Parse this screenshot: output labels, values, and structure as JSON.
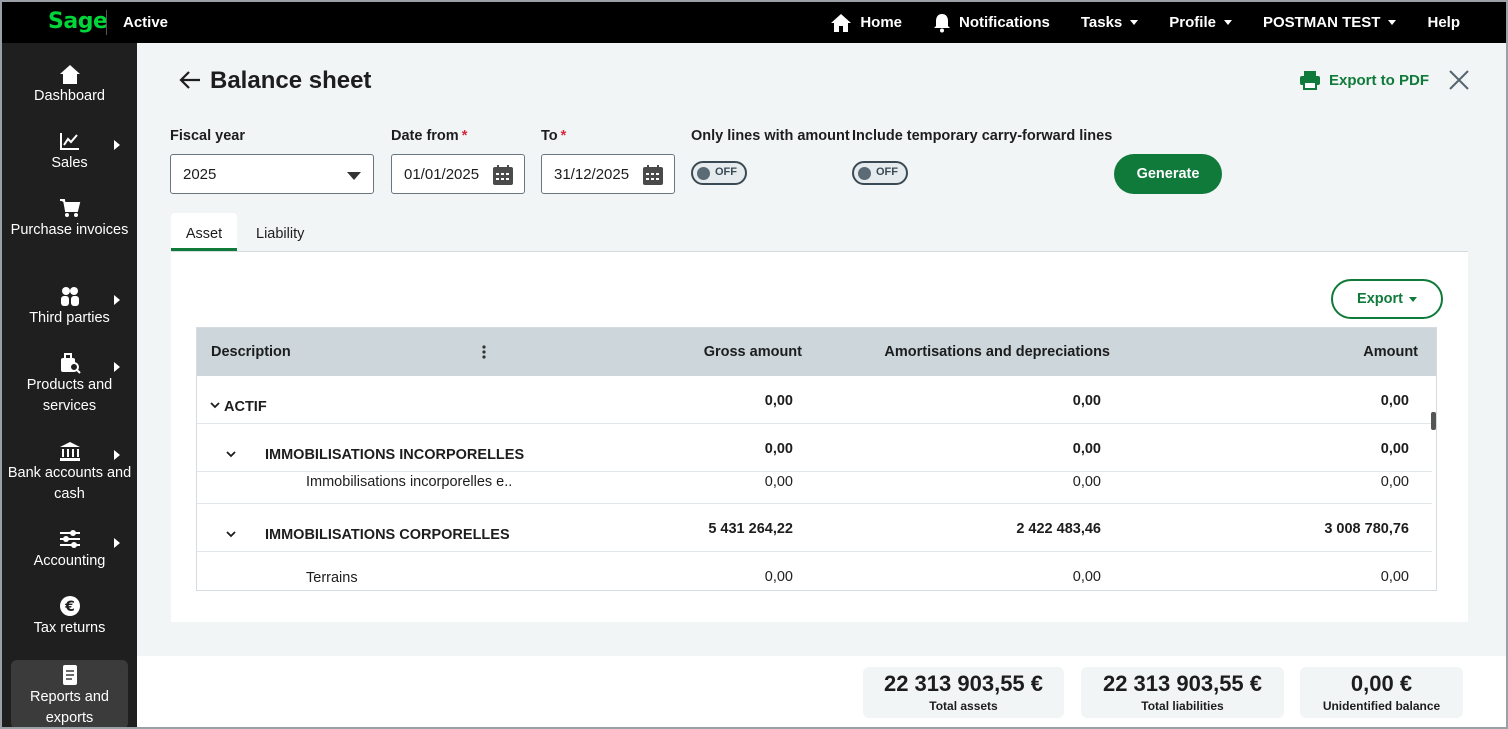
{
  "topbar": {
    "logo": "Sage",
    "company_status": "Active",
    "nav": {
      "home": "Home",
      "notifications": "Notifications",
      "tasks": "Tasks",
      "profile": "Profile",
      "user": "POSTMAN TEST",
      "help": "Help"
    }
  },
  "sidebar": {
    "items": [
      {
        "label": "Dashboard",
        "icon": "home-icon"
      },
      {
        "label": "Sales",
        "icon": "chart-icon"
      },
      {
        "label": "Purchase invoices",
        "icon": "cart-icon"
      },
      {
        "label": "Third parties",
        "icon": "people-icon"
      },
      {
        "label": "Products and services",
        "icon": "box-search-icon"
      },
      {
        "label": "Bank accounts and cash",
        "icon": "bank-icon"
      },
      {
        "label": "Accounting",
        "icon": "sliders-icon"
      },
      {
        "label": "Tax returns",
        "icon": "euro-icon"
      },
      {
        "label": "Reports and exports",
        "icon": "report-icon"
      }
    ]
  },
  "page": {
    "title": "Balance sheet",
    "export_pdf": "Export to PDF"
  },
  "filters": {
    "fiscal_year_label": "Fiscal year",
    "fiscal_year_value": "2025",
    "date_from_label": "Date from",
    "date_from_value": "01/01/2025",
    "to_label": "To",
    "to_value": "31/12/2025",
    "required_mark": "*",
    "only_lines_label": "Only lines with amount",
    "only_lines_state": "OFF",
    "carry_forward_label": "Include temporary carry-forward lines",
    "carry_forward_state": "OFF",
    "generate": "Generate"
  },
  "tabs": {
    "asset": "Asset",
    "liability": "Liability"
  },
  "table": {
    "export": "Export",
    "columns": {
      "description": "Description",
      "gross": "Gross amount",
      "amort": "Amortisations and depreciations",
      "amount": "Amount"
    },
    "rows": [
      {
        "label": "ACTIF",
        "gross": "0,00",
        "amort": "0,00",
        "amount": "0,00"
      },
      {
        "label": "IMMOBILISATIONS INCORPORELLES",
        "gross": "0,00",
        "amort": "0,00",
        "amount": "0,00"
      },
      {
        "label": "Immobilisations incorporelles e..",
        "gross": "0,00",
        "amort": "0,00",
        "amount": "0,00"
      },
      {
        "label": "IMMOBILISATIONS CORPORELLES",
        "gross": "5 431 264,22",
        "amort": "2 422 483,46",
        "amount": "3 008 780,76"
      },
      {
        "label": "Terrains",
        "gross": "0,00",
        "amort": "0,00",
        "amount": "0,00"
      }
    ]
  },
  "totals": {
    "assets_value": "22 313 903,55 €",
    "assets_label": "Total assets",
    "liabilities_value": "22 313 903,55 €",
    "liabilities_label": "Total liabilities",
    "unidentified_value": "0,00 €",
    "unidentified_label": "Unidentified balance"
  },
  "colors": {
    "brand_green": "#0f7a3a",
    "logo_green": "#00d639",
    "topbar": "#000000",
    "sidebar": "#1f1f1f",
    "grid_header": "#ccd6db"
  }
}
